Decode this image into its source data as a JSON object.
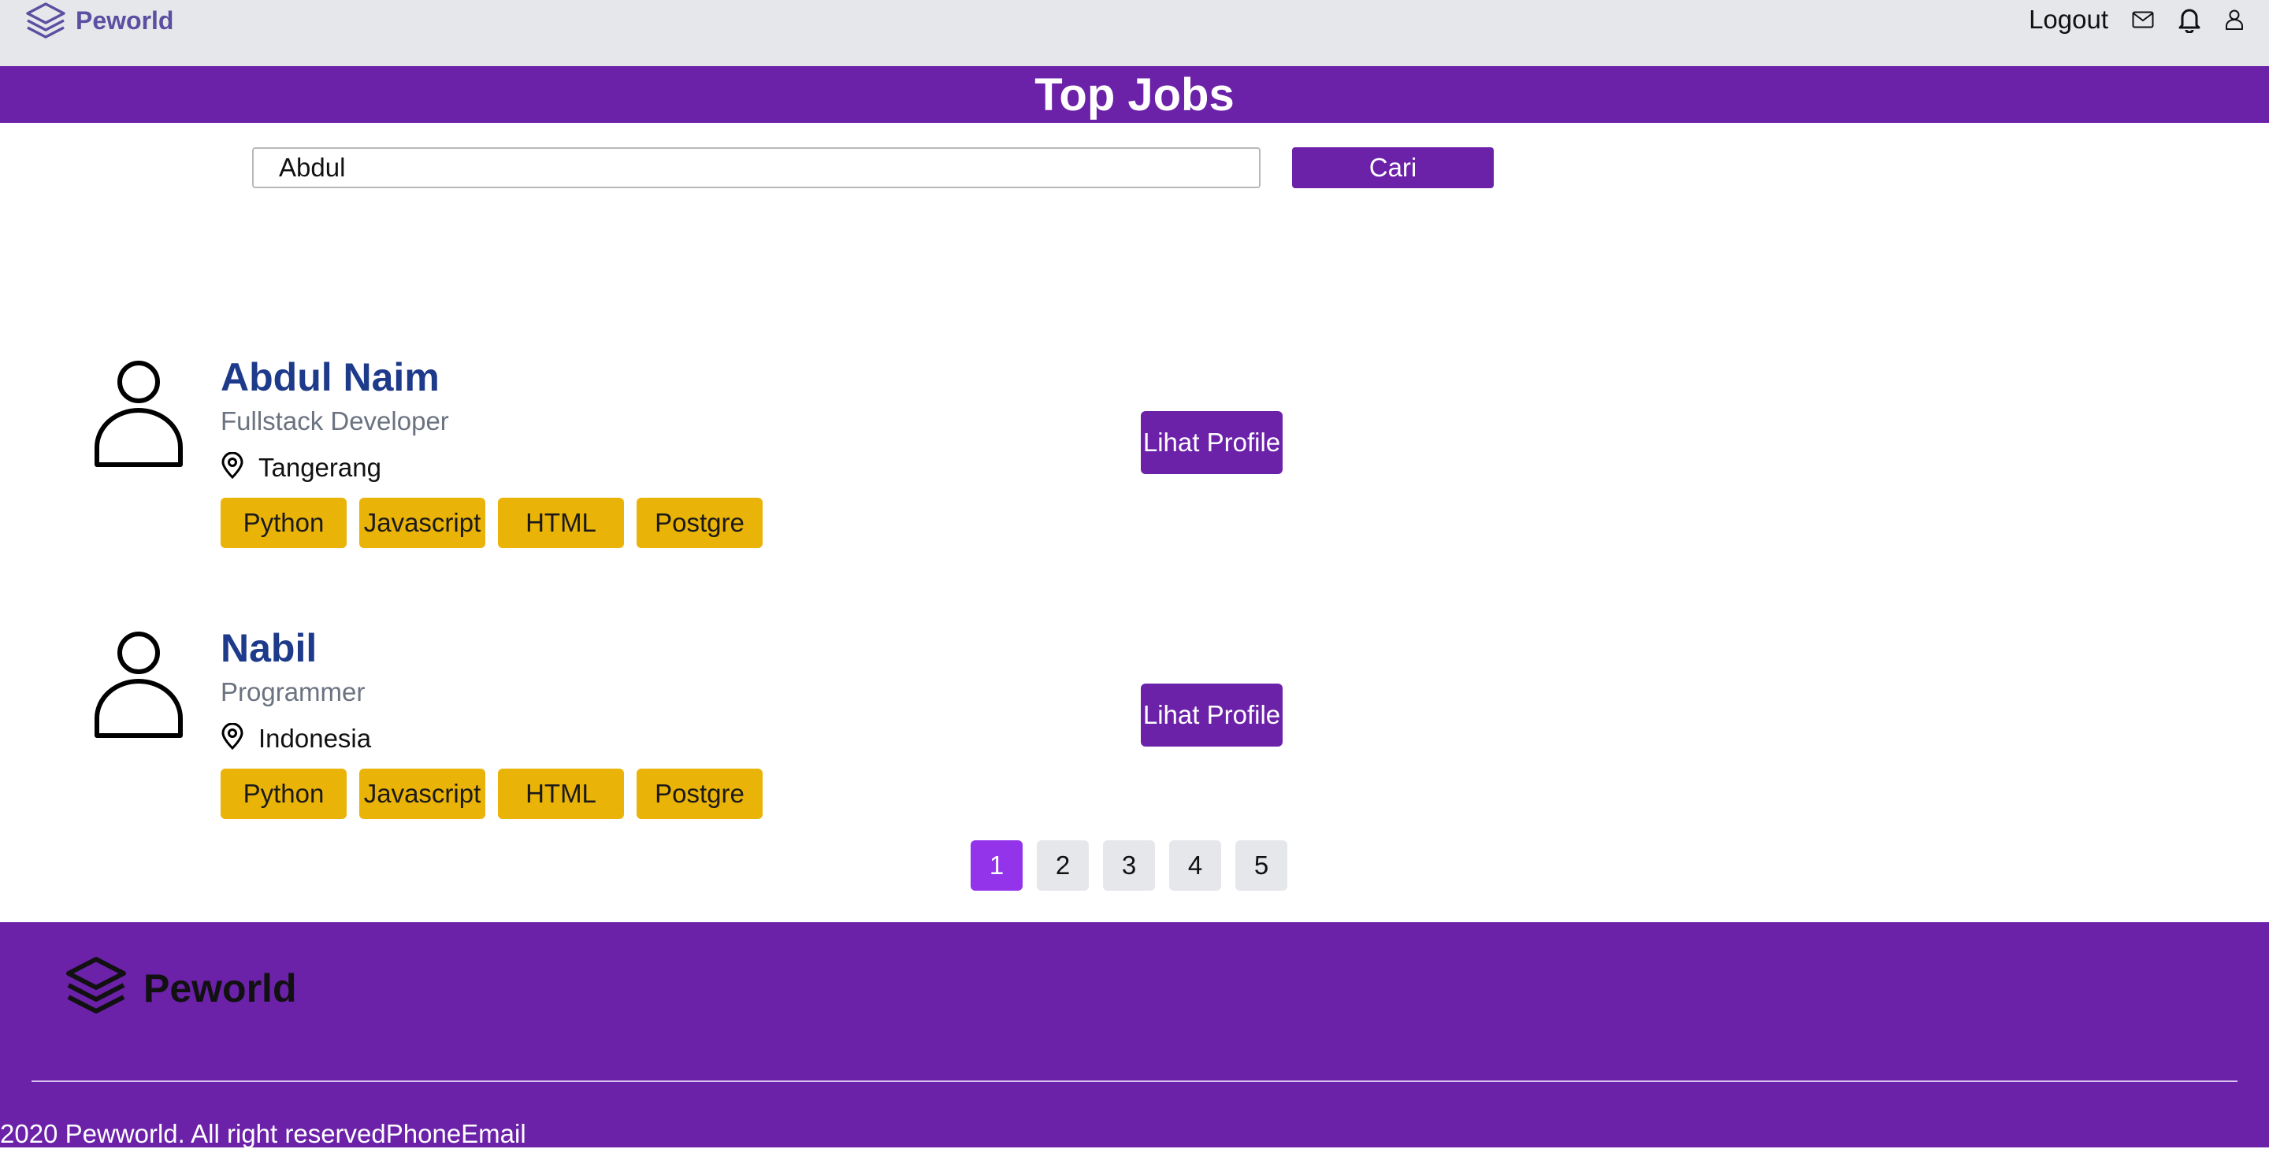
{
  "navbar": {
    "brand": "Peworld",
    "logout_label": "Logout",
    "icons": [
      "mail-icon",
      "bell-icon",
      "user-icon"
    ]
  },
  "header": {
    "title": "Top Jobs"
  },
  "search": {
    "value": "Abdul",
    "button_label": "Cari"
  },
  "results": [
    {
      "name": "Abdul Naim",
      "role": "Fullstack Developer",
      "location": "Tangerang",
      "skills": [
        "Python",
        "Javascript",
        "HTML",
        "Postgre"
      ],
      "button_label": "Lihat Profile"
    },
    {
      "name": "Nabil",
      "role": "Programmer",
      "location": "Indonesia",
      "skills": [
        "Python",
        "Javascript",
        "HTML",
        "Postgre"
      ],
      "button_label": "Lihat Profile"
    }
  ],
  "pagination": {
    "pages": [
      "1",
      "2",
      "3",
      "4",
      "5"
    ],
    "current": "1"
  },
  "footer": {
    "brand": "Peworld",
    "copyright": "2020 Pewworld. All right reservedPhoneEmail"
  },
  "colors": {
    "primary": "#6b21a8",
    "active_page": "#9333ea",
    "skill_badge": "#eab308",
    "name_text": "#1e3a8a",
    "navbar_bg": "#e5e7eb"
  }
}
